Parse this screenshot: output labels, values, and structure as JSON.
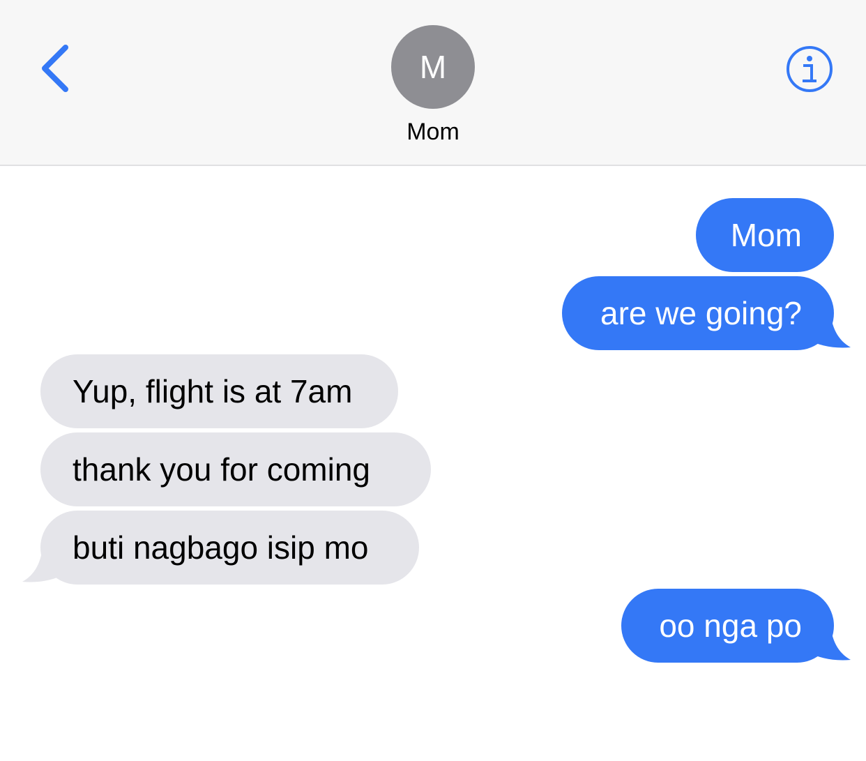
{
  "header": {
    "back_icon": "chevron-left-icon",
    "contact_initial": "M",
    "contact_name": "Mom",
    "info_icon": "info-circle-icon"
  },
  "colors": {
    "accent": "#3478f6",
    "sent_bubble": "#3478f6",
    "received_bubble": "#e5e5ea",
    "avatar_bg": "#8e8e93",
    "header_bg": "#f7f7f7"
  },
  "messages": [
    {
      "direction": "sent",
      "text": "Mom"
    },
    {
      "direction": "sent",
      "text": "are we going?"
    },
    {
      "direction": "received",
      "text": "Yup, flight is at 7am"
    },
    {
      "direction": "received",
      "text": "thank you for coming"
    },
    {
      "direction": "received",
      "text": "buti nagbago isip mo"
    },
    {
      "direction": "sent",
      "text": "oo nga po"
    }
  ]
}
